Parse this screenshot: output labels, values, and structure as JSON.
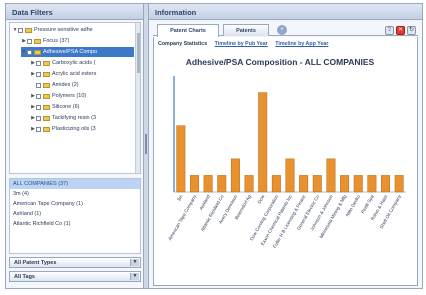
{
  "left_panel": {
    "title": "Data Filters",
    "tree": [
      {
        "label": "Pressure sensitive adhe",
        "indent": 0,
        "twisty": "▼"
      },
      {
        "label": "Focus (37)",
        "indent": 1,
        "twisty": "▶"
      },
      {
        "label": "Adhesive/PSA Compo",
        "indent": 1,
        "twisty": "▼",
        "selected": true
      },
      {
        "label": "Carboxylic acids (",
        "indent": 2,
        "twisty": "▶"
      },
      {
        "label": "Acrylic acid esters",
        "indent": 2,
        "twisty": "▶"
      },
      {
        "label": "Amides (2)",
        "indent": 2,
        "twisty": ""
      },
      {
        "label": "Polymers (10)",
        "indent": 2,
        "twisty": "▶"
      },
      {
        "label": "Silicone (6)",
        "indent": 2,
        "twisty": "▶"
      },
      {
        "label": "Tackifying resin (3",
        "indent": 2,
        "twisty": "▶"
      },
      {
        "label": "Plasticizing oils (3",
        "indent": 2,
        "twisty": "▶"
      }
    ],
    "companies": [
      {
        "label": "ALL COMPANIES (37)",
        "selected": true
      },
      {
        "label": "3m (4)"
      },
      {
        "label": "American Tape Company (1)"
      },
      {
        "label": "Ashland (1)"
      },
      {
        "label": "Atlantic Richfield Co (1)"
      }
    ],
    "patent_types_label": "All Patent Types",
    "tags_label": "All Tags"
  },
  "right_panel": {
    "title": "Information",
    "tabs": [
      "Patent Charts",
      "Patents"
    ],
    "add_tab_icon": "+",
    "company_statistics_label": "Company Statistics",
    "links": [
      "Timeline by Pub Year",
      "Timeline by App Year"
    ]
  },
  "chart_data": {
    "type": "bar",
    "title": "Adhesive/PSA Composition - ALL COMPANIES",
    "categories": [
      "3m",
      "American Tape Company",
      "Ashland",
      "Atlantic Richfield Co",
      "Avery Dennison",
      "Beiersdorf Ag",
      "Dow",
      "Dow Corning Corporation",
      "Exxon Chemical Patents Inc",
      "Fuller H B Licensing & Financ",
      "General Electric Co",
      "Johnson & Johnson",
      "Minnesota Mining & Mfg",
      "Nitto Denko",
      "Pirelli Spa",
      "Rohm & Haas",
      "Shell Oil Company"
    ],
    "values": [
      4,
      1,
      1,
      1,
      2,
      1,
      6,
      1,
      2,
      1,
      1,
      2,
      1,
      1,
      1,
      1,
      1
    ],
    "ylim": [
      0,
      7
    ],
    "bar_color": "#e8912f",
    "bar_stroke": "#b36a18",
    "grid": false
  },
  "colors": {
    "accent": "#3d78c9",
    "header_text": "#31456b",
    "link": "#2f5fb0"
  }
}
